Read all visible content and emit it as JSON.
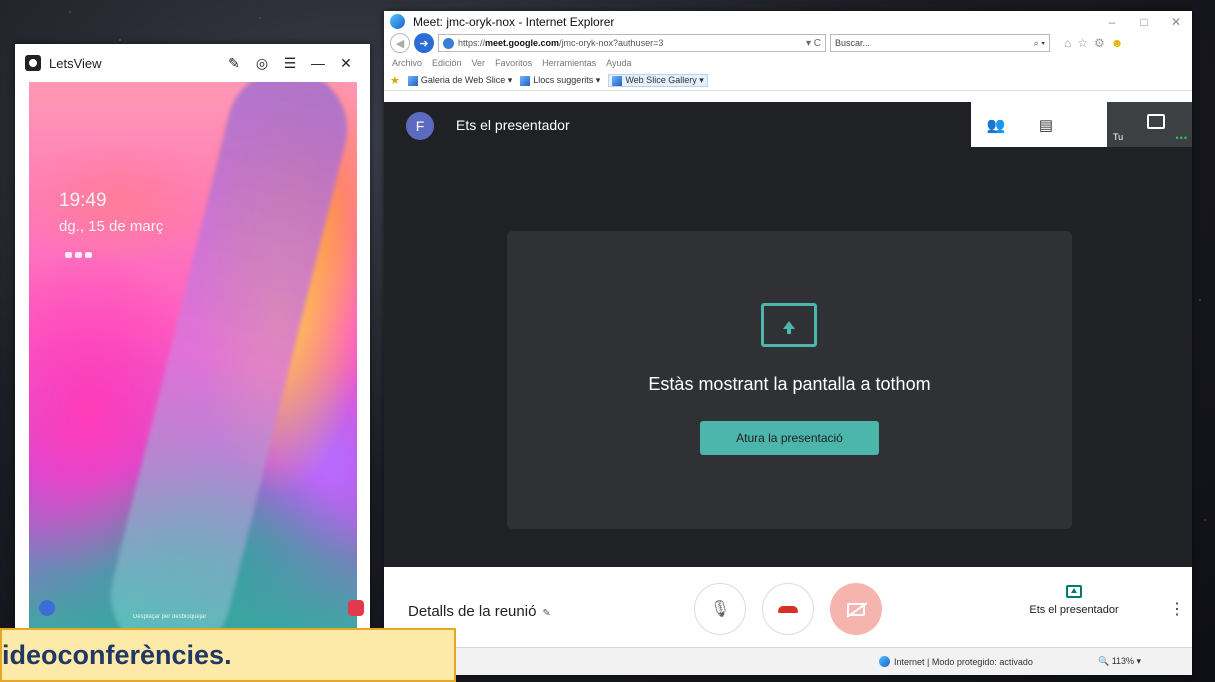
{
  "letsview": {
    "title": "LetsView",
    "controls": [
      "✎",
      "◎",
      "☰",
      "—",
      "✕"
    ],
    "phone": {
      "time": "19:49",
      "date": "dg., 15 de març",
      "unlock_hint": "Desplaçar per desbloquejar"
    }
  },
  "ie": {
    "window_title": "Meet: jmc-oryk-nox - Internet Explorer",
    "window_controls": [
      "–",
      "□",
      "✕"
    ],
    "address": {
      "url_prefix": "https://",
      "url_domain": "meet.google.com",
      "url_path": "/jmc-oryk-nox?authuser=3",
      "tools": "▾ C"
    },
    "search": {
      "placeholder": "Buscar...",
      "icon": "⌕ ▾"
    },
    "toolbar_icons": {
      "home": "⌂",
      "favorites": "☆",
      "settings": "⚙",
      "smile": "☻"
    },
    "menu": [
      "Archivo",
      "Edición",
      "Ver",
      "Favoritos",
      "Herramientas",
      "Ayuda"
    ],
    "favorites_bar": [
      {
        "label": "Galeria de Web Slice ▾"
      },
      {
        "label": "Llocs suggerits ▾"
      },
      {
        "label": "Web Slice Gallery ▾"
      }
    ],
    "status": {
      "zone": "Internet | Modo protegido: activado",
      "zoom": "🔍 113%  ▾"
    }
  },
  "meet": {
    "avatar_letter": "F",
    "presenter_title": "Ets el presentador",
    "top_icons": {
      "people": "👥",
      "chat": "▤"
    },
    "self_label": "Tu",
    "self_dots": "•••",
    "card": {
      "message": "Estàs mostrant la pantalla a tothom",
      "stop_button": "Atura la presentació"
    },
    "bottom": {
      "details": "Detalls de la reunió",
      "details_caret": "✎",
      "mic_icon": "🎙",
      "presenter_label": "Ets el presentador",
      "more_icon": "⋮"
    }
  },
  "caption": {
    "text": "ideoconferències."
  },
  "colors": {
    "meet_bg": "#202124",
    "meet_card": "#303134",
    "accent_teal": "#4db6ac",
    "hangup_red": "#d93025",
    "camera_off": "#f6b4ae",
    "caption_bg": "#fde9a8",
    "caption_border": "#e6a723",
    "caption_text": "#1f3864"
  }
}
